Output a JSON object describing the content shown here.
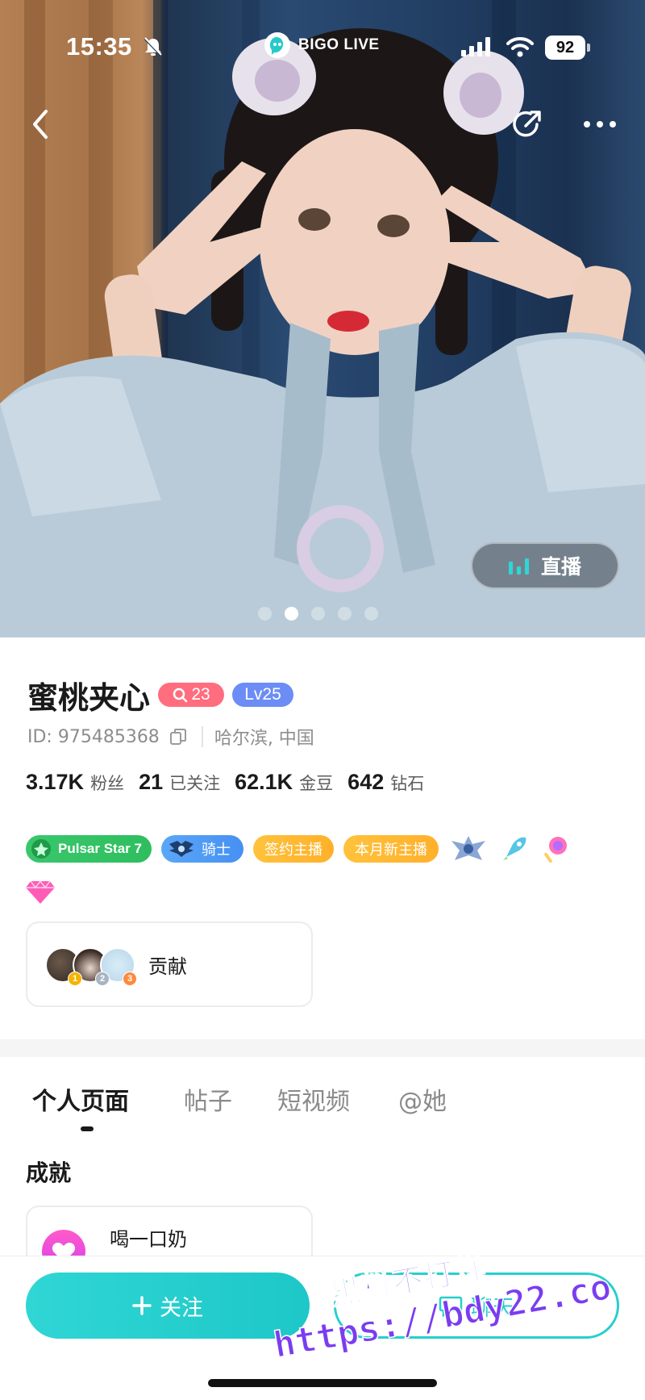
{
  "status_bar": {
    "time": "15:35",
    "battery": "92",
    "brand_name": "BIGO LIVE"
  },
  "hero": {
    "live_label": "直播",
    "carousel_total": 5,
    "carousel_active_index": 1
  },
  "profile": {
    "name": "蜜桃夹心",
    "fans_badge_value": "23",
    "level_badge": "Lv25",
    "id_text": "ID: 975485368",
    "location": "哈尔滨, 中国",
    "stats": [
      {
        "value": "3.17K",
        "label": "粉丝"
      },
      {
        "value": "21",
        "label": "已关注"
      },
      {
        "value": "62.1K",
        "label": "金豆"
      },
      {
        "value": "642",
        "label": "钻石"
      }
    ],
    "badges": {
      "pulsar": "Pulsar Star 7",
      "knight": "骑士",
      "signed": "签约主播",
      "new_this_month": "本月新主播"
    },
    "contribution": {
      "label": "贡献",
      "ranks": [
        "1",
        "2",
        "3"
      ]
    }
  },
  "tabs": [
    {
      "label": "个人页面",
      "active": true
    },
    {
      "label": "帖子",
      "active": false
    },
    {
      "label": "短视频",
      "active": false
    },
    {
      "label": "@她",
      "active": false
    }
  ],
  "achievements": {
    "section_title": "成就",
    "first_title": "喝一口奶"
  },
  "bottom_bar": {
    "follow_label": "关注",
    "chat_label": "聊天"
  },
  "watermark": {
    "line1": "黑料不打烊",
    "line2": "https://bdy22.co"
  },
  "colors": {
    "accent_teal": "#1ec7c8",
    "fans_badge": "#ff6d7f",
    "level_badge": "#6b8df5",
    "pulsar_green": "#2ebe5f",
    "knight_blue": "#4690f2",
    "yellow_badge": "#ffb02a"
  }
}
